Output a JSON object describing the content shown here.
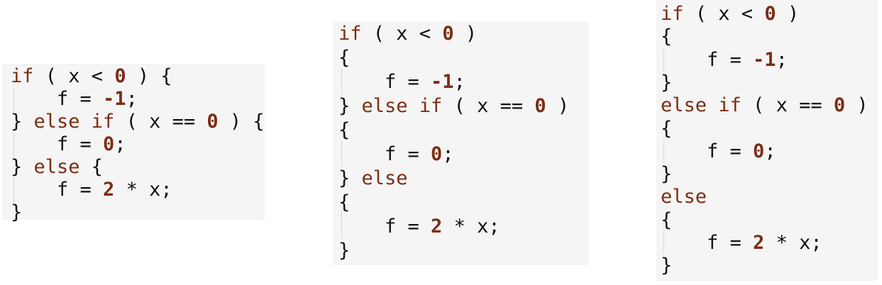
{
  "blocks": [
    {
      "lines": [
        [
          [
            "if",
            "kw"
          ],
          [
            " ( x < ",
            "sym"
          ],
          [
            "0",
            "num"
          ],
          [
            " ) {",
            "sym"
          ]
        ],
        [
          [
            "    f = ",
            "sym"
          ],
          [
            "-1",
            "num"
          ],
          [
            ";",
            "sym"
          ]
        ],
        [
          [
            "} ",
            "sym"
          ],
          [
            "else if",
            "kw"
          ],
          [
            " ( x == ",
            "sym"
          ],
          [
            "0",
            "num"
          ],
          [
            " ) {",
            "sym"
          ]
        ],
        [
          [
            "    f = ",
            "sym"
          ],
          [
            "0",
            "num"
          ],
          [
            ";",
            "sym"
          ]
        ],
        [
          [
            "} ",
            "sym"
          ],
          [
            "else",
            "kw"
          ],
          [
            " {",
            "sym"
          ]
        ],
        [
          [
            "    f = ",
            "sym"
          ],
          [
            "2",
            "num"
          ],
          [
            " * x;",
            "sym"
          ]
        ],
        [
          [
            "}",
            "sym"
          ]
        ]
      ]
    },
    {
      "lines": [
        [
          [
            "if",
            "kw"
          ],
          [
            " ( x < ",
            "sym"
          ],
          [
            "0",
            "num"
          ],
          [
            " )",
            "sym"
          ]
        ],
        [
          [
            "{",
            "sym"
          ]
        ],
        [
          [
            "    f = ",
            "sym"
          ],
          [
            "-1",
            "num"
          ],
          [
            ";",
            "sym"
          ]
        ],
        [
          [
            "} ",
            "sym"
          ],
          [
            "else if",
            "kw"
          ],
          [
            " ( x == ",
            "sym"
          ],
          [
            "0",
            "num"
          ],
          [
            " )",
            "sym"
          ]
        ],
        [
          [
            "{",
            "sym"
          ]
        ],
        [
          [
            "    f = ",
            "sym"
          ],
          [
            "0",
            "num"
          ],
          [
            ";",
            "sym"
          ]
        ],
        [
          [
            "} ",
            "sym"
          ],
          [
            "else",
            "kw"
          ]
        ],
        [
          [
            "{",
            "sym"
          ]
        ],
        [
          [
            "    f = ",
            "sym"
          ],
          [
            "2",
            "num"
          ],
          [
            " * x;",
            "sym"
          ]
        ],
        [
          [
            "}",
            "sym"
          ]
        ]
      ]
    },
    {
      "lines": [
        [
          [
            "if",
            "kw"
          ],
          [
            " ( x < ",
            "sym"
          ],
          [
            "0",
            "num"
          ],
          [
            " )",
            "sym"
          ]
        ],
        [
          [
            "{",
            "sym"
          ]
        ],
        [
          [
            "    f = ",
            "sym"
          ],
          [
            "-1",
            "num"
          ],
          [
            ";",
            "sym"
          ]
        ],
        [
          [
            "}",
            "sym"
          ]
        ],
        [
          [
            "else if",
            "kw"
          ],
          [
            " ( x == ",
            "sym"
          ],
          [
            "0",
            "num"
          ],
          [
            " )",
            "sym"
          ]
        ],
        [
          [
            "{",
            "sym"
          ]
        ],
        [
          [
            "    f = ",
            "sym"
          ],
          [
            "0",
            "num"
          ],
          [
            ";",
            "sym"
          ]
        ],
        [
          [
            "}",
            "sym"
          ]
        ],
        [
          [
            "else",
            "kw"
          ]
        ],
        [
          [
            "{",
            "sym"
          ]
        ],
        [
          [
            "    f = ",
            "sym"
          ],
          [
            "2",
            "num"
          ],
          [
            " * x;",
            "sym"
          ]
        ],
        [
          [
            "}",
            "sym"
          ]
        ]
      ]
    }
  ]
}
